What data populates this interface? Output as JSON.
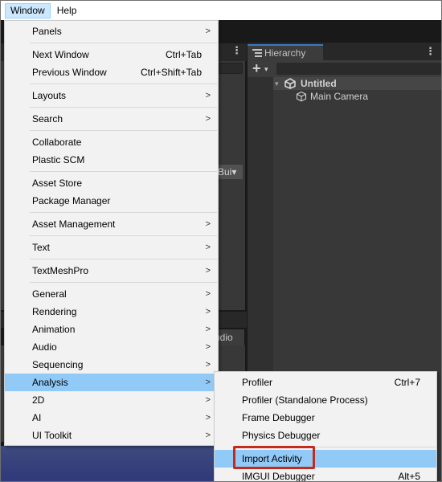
{
  "menubar": {
    "items": [
      {
        "label": "Window",
        "active": true
      },
      {
        "label": "Help",
        "active": false
      }
    ]
  },
  "editor": {
    "build_dropdown_label": "Bui",
    "audio_tab_label": "udio"
  },
  "hierarchy": {
    "tab_label": "Hierarchy",
    "add_label": "+",
    "add_caret": "▾",
    "scene_name": "Untitled",
    "scene_arrow": "▾",
    "camera_name": "Main Camera",
    "menu_dots": "⋮"
  },
  "window_menu": {
    "groups": [
      [
        {
          "label": "Panels",
          "shortcut": "",
          "submenu": true
        }
      ],
      [
        {
          "label": "Next Window",
          "shortcut": "Ctrl+Tab",
          "submenu": false
        },
        {
          "label": "Previous Window",
          "shortcut": "Ctrl+Shift+Tab",
          "submenu": false
        }
      ],
      [
        {
          "label": "Layouts",
          "shortcut": "",
          "submenu": true
        }
      ],
      [
        {
          "label": "Search",
          "shortcut": "",
          "submenu": true
        }
      ],
      [
        {
          "label": "Collaborate",
          "shortcut": "",
          "submenu": false
        },
        {
          "label": "Plastic SCM",
          "shortcut": "",
          "submenu": false
        }
      ],
      [
        {
          "label": "Asset Store",
          "shortcut": "",
          "submenu": false
        },
        {
          "label": "Package Manager",
          "shortcut": "",
          "submenu": false
        }
      ],
      [
        {
          "label": "Asset Management",
          "shortcut": "",
          "submenu": true
        }
      ],
      [
        {
          "label": "Text",
          "shortcut": "",
          "submenu": true
        }
      ],
      [
        {
          "label": "TextMeshPro",
          "shortcut": "",
          "submenu": true
        }
      ],
      [
        {
          "label": "General",
          "shortcut": "",
          "submenu": true
        },
        {
          "label": "Rendering",
          "shortcut": "",
          "submenu": true
        },
        {
          "label": "Animation",
          "shortcut": "",
          "submenu": true
        },
        {
          "label": "Audio",
          "shortcut": "",
          "submenu": true
        },
        {
          "label": "Sequencing",
          "shortcut": "",
          "submenu": true
        },
        {
          "label": "Analysis",
          "shortcut": "",
          "submenu": true,
          "highlight": true
        },
        {
          "label": "2D",
          "shortcut": "",
          "submenu": true
        },
        {
          "label": "AI",
          "shortcut": "",
          "submenu": true
        },
        {
          "label": "UI Toolkit",
          "shortcut": "",
          "submenu": true
        }
      ]
    ],
    "submenu_arrow": ">"
  },
  "analysis_submenu": {
    "groups": [
      [
        {
          "label": "Profiler",
          "shortcut": "Ctrl+7"
        },
        {
          "label": "Profiler (Standalone Process)",
          "shortcut": ""
        },
        {
          "label": "Frame Debugger",
          "shortcut": ""
        },
        {
          "label": "Physics Debugger",
          "shortcut": ""
        }
      ],
      [
        {
          "label": "Import Activity",
          "shortcut": "",
          "highlight": true,
          "outlined": true
        },
        {
          "label": "IMGUI Debugger",
          "shortcut": "Alt+5"
        }
      ]
    ]
  },
  "colors": {
    "menu_bg": "#f2f2f2",
    "menu_highlight": "#91c9f7",
    "menubar_active": "#cce8ff",
    "outline_red": "#c42b1c",
    "editor_panel": "#383838",
    "tab_accent": "#3a79bb"
  }
}
